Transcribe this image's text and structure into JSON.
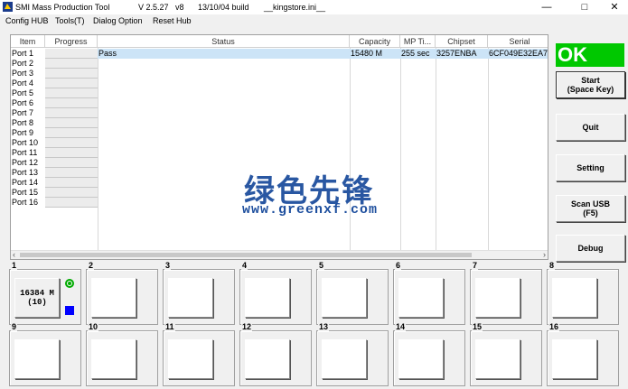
{
  "window": {
    "title": "SMI Mass Production Tool",
    "version": "V 2.5.27   v8",
    "build": "13/10/04 build",
    "ini": "__kingstore.ini__"
  },
  "menu": [
    "Config HUB",
    "Tools(T)",
    "Dialog Option",
    "Reset Hub"
  ],
  "table": {
    "columns": [
      "Item",
      "Progress",
      "Status",
      "Capacity",
      "MP Ti...",
      "Chipset",
      "Serial"
    ],
    "rows": [
      {
        "item": "Port 1",
        "status": "Pass",
        "capacity": "15480 M",
        "mp_time": "255 sec",
        "chipset": "3257ENBA",
        "serial": "6CF049E32EA7"
      },
      {
        "item": "Port 2"
      },
      {
        "item": "Port 3"
      },
      {
        "item": "Port 4"
      },
      {
        "item": "Port 5"
      },
      {
        "item": "Port 6"
      },
      {
        "item": "Port 7"
      },
      {
        "item": "Port 8"
      },
      {
        "item": "Port 9"
      },
      {
        "item": "Port 10"
      },
      {
        "item": "Port 11"
      },
      {
        "item": "Port 12"
      },
      {
        "item": "Port 13"
      },
      {
        "item": "Port 14"
      },
      {
        "item": "Port 15"
      },
      {
        "item": "Port 16"
      }
    ]
  },
  "status_indicator": {
    "text": "OK",
    "color": "#00c800"
  },
  "side_buttons": {
    "start": "Start\n(Space Key)",
    "quit": "Quit",
    "setting": "Setting",
    "scan_usb": "Scan USB\n(F5)",
    "debug": "Debug"
  },
  "ports": [
    {
      "num": "1",
      "line1": "16384 M",
      "line2": "(10)"
    },
    {
      "num": "2"
    },
    {
      "num": "3"
    },
    {
      "num": "4"
    },
    {
      "num": "5"
    },
    {
      "num": "6"
    },
    {
      "num": "7"
    },
    {
      "num": "8"
    },
    {
      "num": "9"
    },
    {
      "num": "10"
    },
    {
      "num": "11"
    },
    {
      "num": "12"
    },
    {
      "num": "13"
    },
    {
      "num": "14"
    },
    {
      "num": "15"
    },
    {
      "num": "16"
    }
  ],
  "watermark": {
    "text": "绿色先锋",
    "url": "www.greenxf.com"
  },
  "colors": {
    "selection": "#cce4f7",
    "ok_green": "#00c800",
    "port_square": "#0000ff"
  }
}
